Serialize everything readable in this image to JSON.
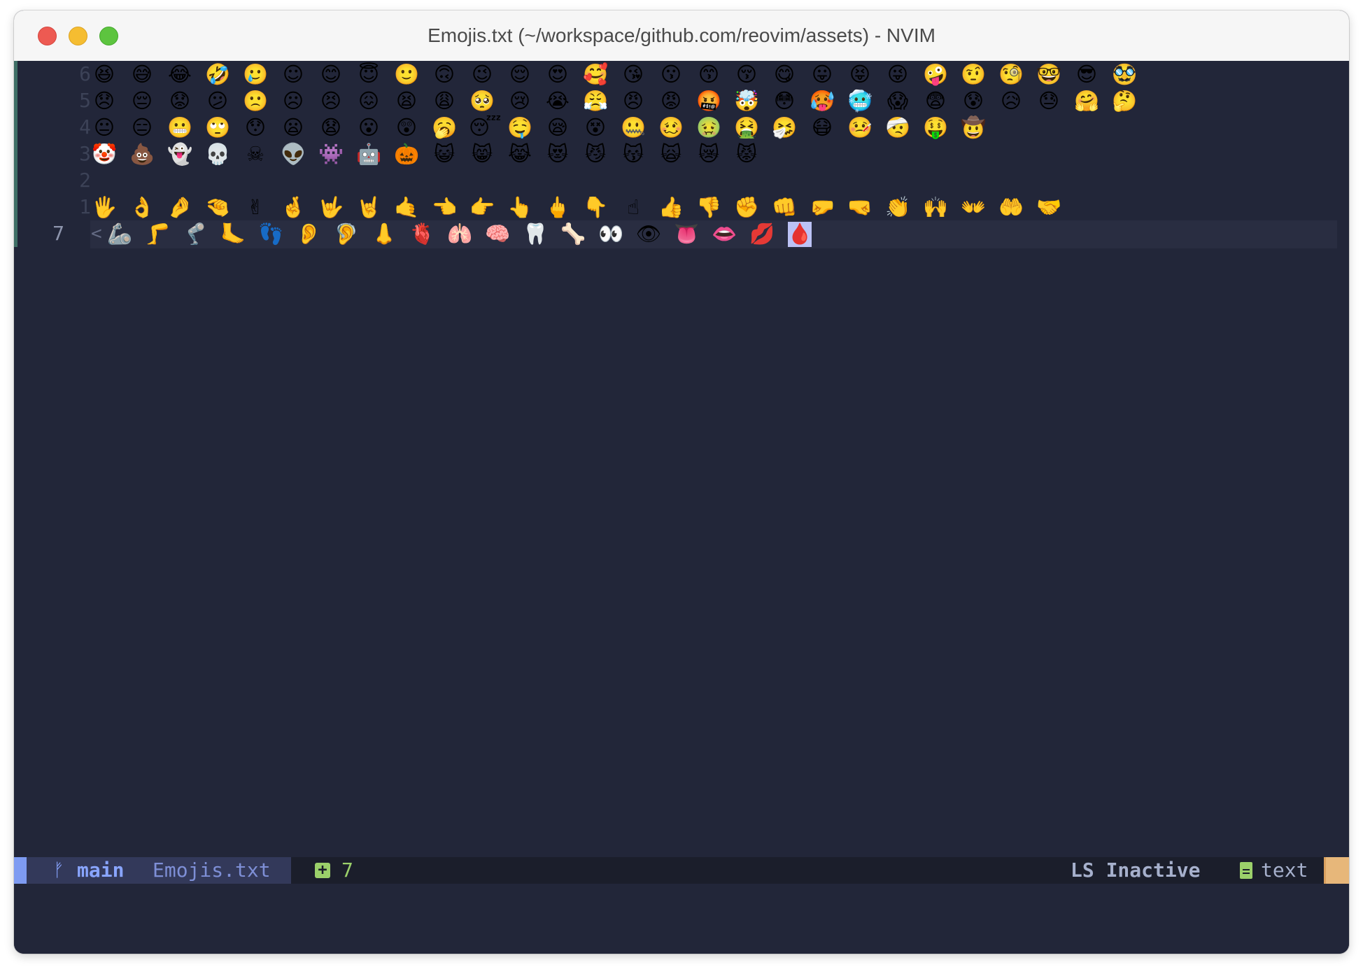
{
  "window": {
    "title": "Emojis.txt (~/workspace/github.com/reovim/assets) - NVIM"
  },
  "editor": {
    "lines": [
      {
        "number": "6",
        "current": false,
        "emojis": [
          "😆",
          "😅",
          "😂",
          "🤣",
          "🥲",
          "☺",
          "😊",
          "😇",
          "🙂",
          "🙃",
          "😉",
          "😌",
          "😍",
          "🥰",
          "😘",
          "😗",
          "😙",
          "😚",
          "😋",
          "😛",
          "😝",
          "😜",
          "🤪",
          "🤨",
          "🧐",
          "🤓",
          "😎",
          "🥸"
        ]
      },
      {
        "number": "5",
        "current": false,
        "emojis": [
          "😞",
          "😔",
          "😟",
          "😕",
          "🙁",
          "☹",
          "😣",
          "😖",
          "😫",
          "😩",
          "🥺",
          "😢",
          "😭",
          "😤",
          "😠",
          "😡",
          "🤬",
          "🤯",
          "😳",
          "🥵",
          "🥶",
          "😱",
          "😨",
          "😰",
          "😥",
          "😓",
          "🤗",
          "🤔"
        ]
      },
      {
        "number": "4",
        "current": false,
        "emojis": [
          "😐",
          "😑",
          "😬",
          "🙄",
          "😯",
          "😦",
          "😧",
          "😮",
          "😲",
          "🥱",
          "😴",
          "🤤",
          "😪",
          "😵",
          "🤐",
          "🥴",
          "🤢",
          "🤮",
          "🤧",
          "😷",
          "🤒",
          "🤕",
          "🤑",
          "🤠"
        ]
      },
      {
        "number": "3",
        "current": false,
        "emojis": [
          "🤡",
          "💩",
          "👻",
          "💀",
          "☠",
          "👽",
          "👾",
          "🤖",
          "🎃",
          "😺",
          "😸",
          "😹",
          "😻",
          "😼",
          "😽",
          "🙀",
          "😿",
          "😾"
        ]
      },
      {
        "number": "2",
        "current": false,
        "emojis": []
      },
      {
        "number": "1",
        "current": false,
        "emojis": [
          "🖐",
          "👌",
          "🤌",
          "🤏",
          "✌",
          "🤞",
          "🤟",
          "🤘",
          "🤙",
          "👈",
          "👉",
          "👆",
          "🖕",
          "👇",
          "☝",
          "👍",
          "👎",
          "✊",
          "👊",
          "🤛",
          "🤜",
          "👏",
          "🙌",
          "👐",
          "🤲",
          "🤝"
        ]
      },
      {
        "number": "7",
        "current": true,
        "prefix": "<",
        "emojis": [
          "🦾",
          "🦵",
          "🦿",
          "🦶",
          "👣",
          "👂",
          "🦻",
          "👃",
          "🫀",
          "🫁",
          "🧠",
          "🦷",
          "🦴",
          "👀",
          "👁",
          "👅",
          "👄",
          "💋",
          "🩸"
        ]
      }
    ]
  },
  "statusline": {
    "branch_icon": "ᚠ",
    "branch": "main",
    "filename": "Emojis.txt",
    "diff_icon": "+",
    "diff_count": "7",
    "lsp_status": "LS Inactive",
    "filetype": "text",
    "colors": {
      "mode": "#7e9bf2",
      "added": "#9bd06a",
      "end": "#e7b77a"
    }
  }
}
